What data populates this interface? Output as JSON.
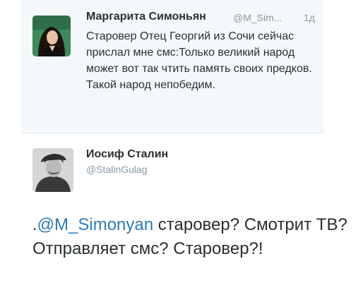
{
  "tweet1": {
    "author_name": "Маргарита Симоньян",
    "handle": "@M_Sim...",
    "time": "1д",
    "text": "Старовер Отец Георгий из Сочи сейчас прислал мне смс:Только великий народ может вот так чтить память своих предков. Такой народ непобедим."
  },
  "tweet2": {
    "author_name": "Иосиф Сталин",
    "handle": "@StalinGulag",
    "text_prefix": ".",
    "mention": "@M_Simonyan",
    "text_rest": " старовер? Смотрит ТВ? Отправляет смс? Старовер?!"
  },
  "colors": {
    "mention_link": "#2b7bb9",
    "secondary_text": "#8899a6",
    "primary_text": "#292f33",
    "quoted_background": "#f5f8fa"
  }
}
